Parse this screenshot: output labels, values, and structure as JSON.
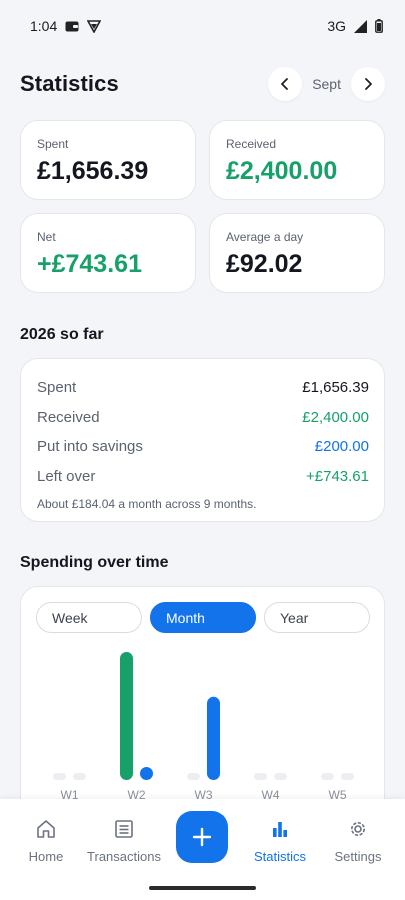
{
  "status_bar": {
    "time": "1:04",
    "network": "3G"
  },
  "header": {
    "title": "Statistics",
    "month": "Sept"
  },
  "stats": [
    {
      "label": "Spent",
      "value": "£1,656.39",
      "color": "#14171f"
    },
    {
      "label": "Received",
      "value": "£2,400.00",
      "color": "#17a06a"
    },
    {
      "label": "Net",
      "value": "+£743.61",
      "color": "#17a06a"
    },
    {
      "label": "Average a day",
      "value": "£92.02",
      "color": "#14171f"
    }
  ],
  "year_summary": {
    "title": "2026 so far",
    "rows": [
      {
        "label": "Spent",
        "value": "£1,656.39",
        "color": "#14171f"
      },
      {
        "label": "Received",
        "value": "£2,400.00",
        "color": "#17a06a"
      },
      {
        "label": "Put into savings",
        "value": "£200.00",
        "color": "#1273ea"
      },
      {
        "label": "Left over",
        "value": "+£743.61",
        "color": "#17a06a"
      }
    ],
    "note": "About £184.04 a month across 9 months."
  },
  "spending_chart": {
    "title": "Spending over time",
    "tabs": [
      {
        "label": "Week",
        "active": false
      },
      {
        "label": "Month",
        "active": true
      },
      {
        "label": "Year",
        "active": false
      }
    ]
  },
  "chart_data": {
    "type": "bar",
    "categories": [
      "W1",
      "W2",
      "W3",
      "W4",
      "W5"
    ],
    "series": [
      {
        "values": [
          0,
          2400,
          0,
          0,
          0
        ],
        "color": "#17a06a"
      },
      {
        "values": [
          0,
          80,
          1560,
          0,
          0
        ],
        "color": "#1273ea"
      }
    ],
    "ylim": [
      0,
      2400
    ],
    "grid": false
  },
  "bottom_nav": {
    "items": [
      {
        "label": "Home",
        "icon": "home-icon",
        "active": false
      },
      {
        "label": "Transactions",
        "icon": "receipt-icon",
        "active": false
      },
      {
        "label": "Statistics",
        "icon": "bar-chart-icon",
        "active": true
      },
      {
        "label": "Settings",
        "icon": "gear-icon",
        "active": false
      }
    ],
    "fab_icon": "plus-icon"
  },
  "colors": {
    "accent": "#1273ea",
    "positive": "#17a06a",
    "background": "#f4f5f9"
  }
}
